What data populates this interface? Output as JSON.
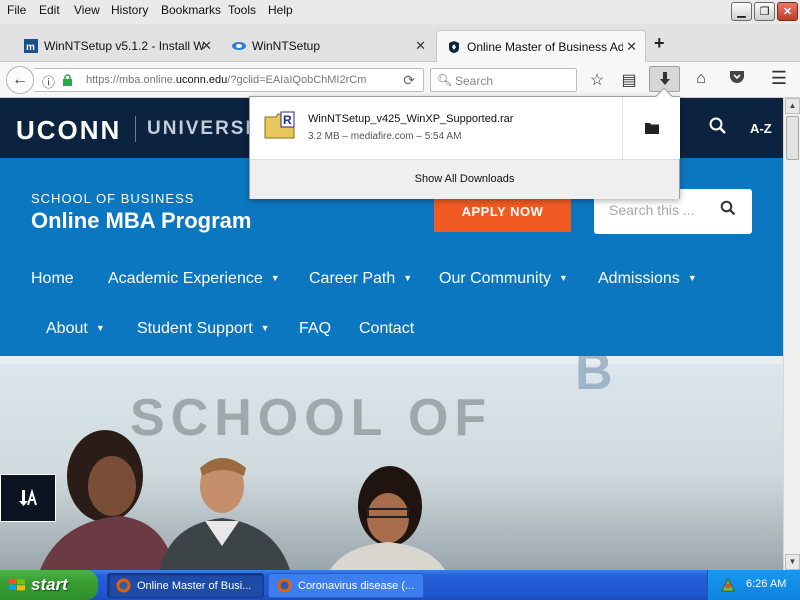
{
  "menu": [
    "File",
    "Edit",
    "View",
    "History",
    "Bookmarks",
    "Tools",
    "Help"
  ],
  "window_buttons": {
    "minimize": "▁",
    "maximize": "❐",
    "close": "✕"
  },
  "tabs": [
    {
      "label": "WinNTSetup v5.1.2 - Install W...",
      "icon": "m-icon"
    },
    {
      "label": "WinNTSetup",
      "icon": "winntsetup-icon"
    },
    {
      "label": "Online Master of Business Adm...",
      "icon": "uconn-crest-icon",
      "active": true
    }
  ],
  "new_tab": "+",
  "url": {
    "prefix": "https://mba.online.",
    "domain": "uconn.edu",
    "suffix": "/?gclid=EAIaIQobChMI2rCm"
  },
  "search_placeholder": "Search",
  "downloads": {
    "file_name": "WinNTSetup_v425_WinXP_Supported.rar",
    "meta": "3.2 MB – mediafire.com – 5:54 AM",
    "show_all": "Show All Downloads"
  },
  "site": {
    "logo": "UCONN",
    "university": "UNIVERSITY",
    "az": "A-Z",
    "school": "SCHOOL OF BUSINESS",
    "program": "Online MBA Program",
    "apply": "APPLY NOW",
    "search_placeholder": "Search this ...",
    "nav_row1": [
      {
        "label": "Home",
        "caret": false
      },
      {
        "label": "Academic Experience",
        "caret": true
      },
      {
        "label": "Career Path",
        "caret": true
      },
      {
        "label": "Our Community",
        "caret": true
      },
      {
        "label": "Admissions",
        "caret": true
      }
    ],
    "nav_row2": [
      {
        "label": "About",
        "caret": true
      },
      {
        "label": "Student Support",
        "caret": true
      },
      {
        "label": "FAQ",
        "caret": false
      },
      {
        "label": "Contact",
        "caret": false
      }
    ],
    "hero_text": "SCHOOL OF",
    "hero_text2": "B"
  },
  "taskbar": {
    "start": "start",
    "tasks": [
      {
        "label": "Online Master of Busi...",
        "active": true
      },
      {
        "label": "Coronavirus disease (...",
        "active": false
      }
    ],
    "clock": "6:26 AM"
  },
  "colors": {
    "uconn_navy": "#0c2340",
    "page_blue": "#0a77c0",
    "apply_orange": "#f15a22"
  }
}
